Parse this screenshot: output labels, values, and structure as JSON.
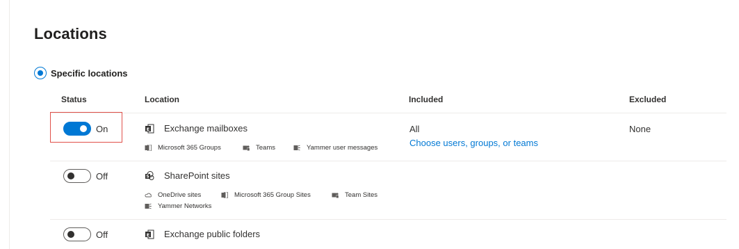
{
  "page": {
    "title": "Locations"
  },
  "scope": {
    "selected_label": "Specific locations"
  },
  "table": {
    "headers": {
      "status": "Status",
      "location": "Location",
      "included": "Included",
      "excluded": "Excluded"
    },
    "rows": [
      {
        "toggle_state": "On",
        "toggle_on": true,
        "name": "Exchange mailboxes",
        "icon": "exchange-icon",
        "sub_items": [
          "Microsoft 365 Groups",
          "Teams",
          "Yammer user messages"
        ],
        "included": "All",
        "included_link": "Choose users, groups, or teams",
        "excluded": "None"
      },
      {
        "toggle_state": "Off",
        "toggle_on": false,
        "name": "SharePoint sites",
        "icon": "sharepoint-icon",
        "sub_items": [
          "OneDrive sites",
          "Microsoft 365 Group Sites",
          "Team Sites",
          "Yammer Networks"
        ]
      },
      {
        "toggle_state": "Off",
        "toggle_on": false,
        "name": "Exchange public folders",
        "icon": "exchange-icon"
      }
    ]
  },
  "colors": {
    "accent": "#0078d4",
    "highlight": "#e0504a",
    "text": "#323130",
    "divider": "#edebe9"
  }
}
